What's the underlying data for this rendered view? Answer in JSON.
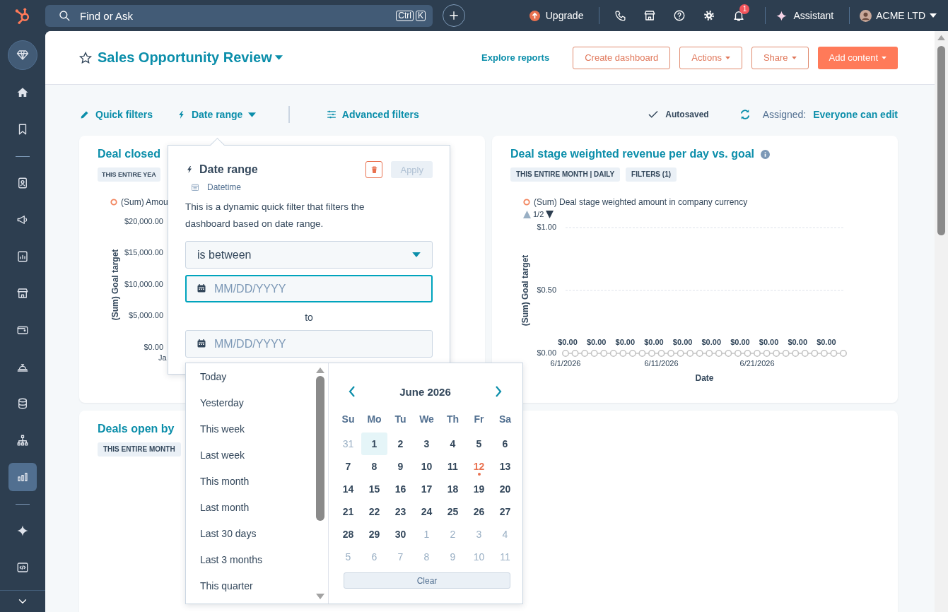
{
  "topbar": {
    "search": {
      "placeholder": "Find or Ask",
      "keys": [
        "Ctrl",
        "K"
      ]
    },
    "upgrade": "Upgrade",
    "notifications": "1",
    "assistant": "Assistant",
    "account": "ACME LTD"
  },
  "sidebar": {
    "groups": [
      [
        {
          "selected": false
        },
        {
          "selected": false
        },
        {
          "selected": false
        }
      ],
      [
        {
          "selected": false
        },
        {
          "selected": false
        },
        {
          "selected": false
        },
        {
          "selected": false
        },
        {
          "selected": false
        },
        {
          "selected": false
        },
        {
          "selected": false
        },
        {
          "selected": false
        },
        {
          "selected": true
        }
      ],
      [
        {
          "selected": false
        },
        {
          "selected": false
        }
      ]
    ]
  },
  "header": {
    "title": "Sales Opportunity Review",
    "link": "Explore reports",
    "buttons": [
      {
        "label": "Create dashboard",
        "kind": "outline",
        "caret": false
      },
      {
        "label": "Actions",
        "kind": "outline",
        "caret": true
      },
      {
        "label": "Share",
        "kind": "outline",
        "caret": true
      },
      {
        "label": "Add content",
        "kind": "primary",
        "caret": true
      }
    ]
  },
  "filter_bar": {
    "quick_filters": "Quick filters",
    "date_range": "Date range",
    "advanced_filters": "Advanced filters",
    "status": "Autosaved",
    "assigned_label": "Assigned:",
    "assigned_value": "Everyone can edit"
  },
  "dashboard": {
    "top_left": {
      "title": "Deal closed",
      "tags": [
        "THIS ENTIRE YEA"
      ],
      "legend": "(Sum) Amou",
      "yticks": [
        "$20,000.00",
        "$15,000.00",
        "$10,000.00",
        "$5,000.00",
        "$0.00"
      ],
      "ylabel": "(Sum) Goal target",
      "xtick": "Ja"
    },
    "top_right": {
      "title": "Deal stage weighted revenue per day vs. goal",
      "tags": [
        "THIS ENTIRE MONTH | DAILY",
        "FILTERS (1)"
      ],
      "pager": "1/2",
      "chart_data": {
        "type": "line",
        "xlabel": "Date",
        "ylabel": "(Sum) Goal target",
        "categories": [
          "6/1/2026",
          null,
          null,
          null,
          null,
          null,
          null,
          null,
          null,
          null,
          "6/11/2026",
          null,
          null,
          null,
          null,
          null,
          null,
          null,
          null,
          null,
          "6/21/2026",
          null,
          null,
          null,
          null,
          null,
          null,
          null,
          null,
          null
        ],
        "ylim": [
          0,
          1
        ],
        "yticks": [
          {
            "value": 0,
            "label": "$0.00"
          },
          {
            "value": 0.5,
            "label": "$0.50"
          },
          {
            "value": 1,
            "label": "$1.00"
          }
        ],
        "series": [
          {
            "name": "(Sum) Deal stage weighted amount in company currency",
            "color": "#c4c4c4",
            "marker": "circle",
            "values": [
              0,
              0,
              0,
              0,
              0,
              0,
              0,
              0,
              0,
              0,
              0,
              0,
              0,
              0,
              0,
              0,
              0,
              0,
              0,
              0,
              0,
              0,
              0,
              0,
              0,
              0,
              0,
              0,
              0,
              0
            ]
          }
        ],
        "value_labels": [
          "$0.00",
          "$0.00",
          "$0.00",
          "$0.00",
          "$0.00",
          "$0.00",
          "$0.00",
          "$0.00",
          "$0.00",
          "$0.00"
        ]
      }
    },
    "bottom": {
      "title": "Deals open by",
      "tags": [
        "THIS ENTIRE MONTH"
      ]
    }
  },
  "popover": {
    "title": "Date range",
    "type": "Datetime",
    "apply": {
      "label": "Apply",
      "disabled": true
    },
    "description": "This is a dynamic quick filter that filters the dashboard based on date range.",
    "operator": "is between",
    "from": {
      "placeholder": "MM/DD/YYYY",
      "focused": true
    },
    "separator": "to",
    "to": {
      "placeholder": "MM/DD/YYYY",
      "focused": false
    }
  },
  "date_picker": {
    "presets": [
      {
        "label": "Today",
        "selected": false
      },
      {
        "label": "Yesterday",
        "selected": false
      },
      {
        "label": "This week",
        "selected": false
      },
      {
        "label": "Last week",
        "selected": false
      },
      {
        "label": "This month",
        "selected": false
      },
      {
        "label": "Last month",
        "selected": false
      },
      {
        "label": "Last 30 days",
        "selected": false
      },
      {
        "label": "Last 3 months",
        "selected": false
      },
      {
        "label": "This quarter",
        "selected": false
      }
    ],
    "month": "June 2026",
    "weekdays": [
      "Su",
      "Mo",
      "Tu",
      "We",
      "Th",
      "Fr",
      "Sa"
    ],
    "weeks": [
      [
        {
          "day": "31",
          "outside": true,
          "selected": false,
          "today": false
        },
        {
          "day": "1",
          "outside": false,
          "selected": true,
          "today": false
        },
        {
          "day": "2",
          "outside": false,
          "selected": false,
          "today": false
        },
        {
          "day": "3",
          "outside": false,
          "selected": false,
          "today": false
        },
        {
          "day": "4",
          "outside": false,
          "selected": false,
          "today": false
        },
        {
          "day": "5",
          "outside": false,
          "selected": false,
          "today": false
        },
        {
          "day": "6",
          "outside": false,
          "selected": false,
          "today": false
        }
      ],
      [
        {
          "day": "7",
          "outside": false,
          "selected": false,
          "today": false
        },
        {
          "day": "8",
          "outside": false,
          "selected": false,
          "today": false
        },
        {
          "day": "9",
          "outside": false,
          "selected": false,
          "today": false
        },
        {
          "day": "10",
          "outside": false,
          "selected": false,
          "today": false
        },
        {
          "day": "11",
          "outside": false,
          "selected": false,
          "today": false
        },
        {
          "day": "12",
          "outside": false,
          "selected": false,
          "today": true
        },
        {
          "day": "13",
          "outside": false,
          "selected": false,
          "today": false
        }
      ],
      [
        {
          "day": "14",
          "outside": false,
          "selected": false,
          "today": false
        },
        {
          "day": "15",
          "outside": false,
          "selected": false,
          "today": false
        },
        {
          "day": "16",
          "outside": false,
          "selected": false,
          "today": false
        },
        {
          "day": "17",
          "outside": false,
          "selected": false,
          "today": false
        },
        {
          "day": "18",
          "outside": false,
          "selected": false,
          "today": false
        },
        {
          "day": "19",
          "outside": false,
          "selected": false,
          "today": false
        },
        {
          "day": "20",
          "outside": false,
          "selected": false,
          "today": false
        }
      ],
      [
        {
          "day": "21",
          "outside": false,
          "selected": false,
          "today": false
        },
        {
          "day": "22",
          "outside": false,
          "selected": false,
          "today": false
        },
        {
          "day": "23",
          "outside": false,
          "selected": false,
          "today": false
        },
        {
          "day": "24",
          "outside": false,
          "selected": false,
          "today": false
        },
        {
          "day": "25",
          "outside": false,
          "selected": false,
          "today": false
        },
        {
          "day": "26",
          "outside": false,
          "selected": false,
          "today": false
        },
        {
          "day": "27",
          "outside": false,
          "selected": false,
          "today": false
        }
      ],
      [
        {
          "day": "28",
          "outside": false,
          "selected": false,
          "today": false
        },
        {
          "day": "29",
          "outside": false,
          "selected": false,
          "today": false
        },
        {
          "day": "30",
          "outside": false,
          "selected": false,
          "today": false
        },
        {
          "day": "1",
          "outside": true,
          "selected": false,
          "today": false
        },
        {
          "day": "2",
          "outside": true,
          "selected": false,
          "today": false
        },
        {
          "day": "3",
          "outside": true,
          "selected": false,
          "today": false
        },
        {
          "day": "4",
          "outside": true,
          "selected": false,
          "today": false
        }
      ],
      [
        {
          "day": "5",
          "outside": true,
          "selected": false,
          "today": false
        },
        {
          "day": "6",
          "outside": true,
          "selected": false,
          "today": false
        },
        {
          "day": "7",
          "outside": true,
          "selected": false,
          "today": false
        },
        {
          "day": "8",
          "outside": true,
          "selected": false,
          "today": false
        },
        {
          "day": "9",
          "outside": true,
          "selected": false,
          "today": false
        },
        {
          "day": "10",
          "outside": true,
          "selected": false,
          "today": false
        },
        {
          "day": "11",
          "outside": true,
          "selected": false,
          "today": false
        }
      ]
    ],
    "clear": "Clear"
  }
}
